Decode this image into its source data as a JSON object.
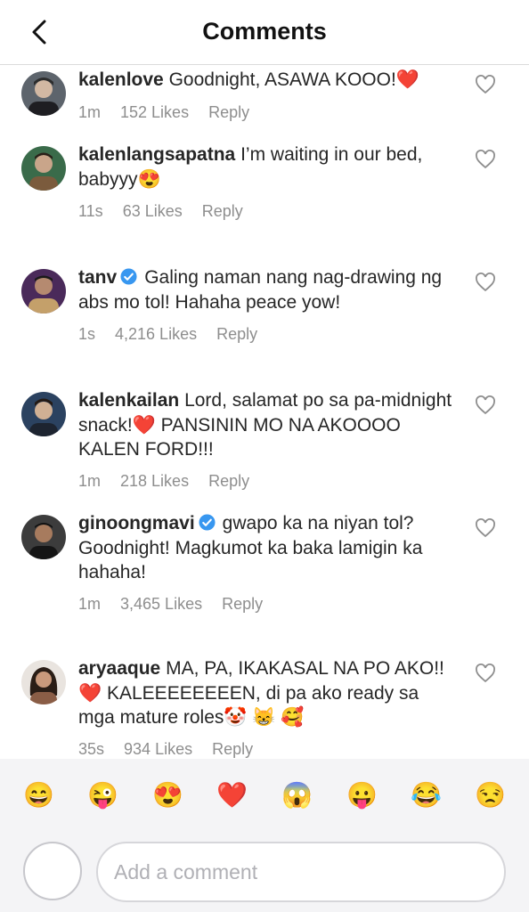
{
  "header": {
    "title": "Comments"
  },
  "comments": [
    {
      "username": "kalenlove",
      "verified": false,
      "text": "Goodnight, ASAWA KOOO!❤️",
      "time": "1m",
      "likes": "152 Likes",
      "reply": "Reply"
    },
    {
      "username": "kalenlangsapatna",
      "verified": false,
      "text": "I’m waiting in our bed, babyyy😍",
      "time": "11s",
      "likes": "63 Likes",
      "reply": "Reply"
    },
    {
      "username": "tanv",
      "verified": true,
      "text": "Galing naman nang nag-drawing ng abs mo tol! Hahaha peace yow!",
      "time": "1s",
      "likes": "4,216 Likes",
      "reply": "Reply"
    },
    {
      "username": "kalenkailan",
      "verified": false,
      "text": "Lord, salamat po sa pa-midnight snack!❤️ PANSININ MO NA AKOOOO KALEN FORD!!!",
      "time": "1m",
      "likes": "218 Likes",
      "reply": "Reply"
    },
    {
      "username": "ginoongmavi",
      "verified": true,
      "text": "gwapo ka na niyan tol? Goodnight! Magkumot ka baka lamigin ka hahaha!",
      "time": "1m",
      "likes": "3,465 Likes",
      "reply": "Reply"
    },
    {
      "username": "aryaaque",
      "verified": false,
      "text": "MA, PA, IKAKASAL NA PO AKO!!❤️ KALEEEEEEEEN, di pa ako ready sa mga mature roles🤡 😸 🥰",
      "time": "35s",
      "likes": "934 Likes",
      "reply": "Reply"
    }
  ],
  "emoji_bar": [
    "😄",
    "😜",
    "😍",
    "❤️",
    "😱",
    "😛",
    "😂",
    "😒"
  ],
  "composer": {
    "placeholder": "Add a comment"
  },
  "colors": {
    "text": "#262626",
    "meta": "#8e8e8e",
    "verified": "#3897f0",
    "tray": "#f4f4f6"
  }
}
